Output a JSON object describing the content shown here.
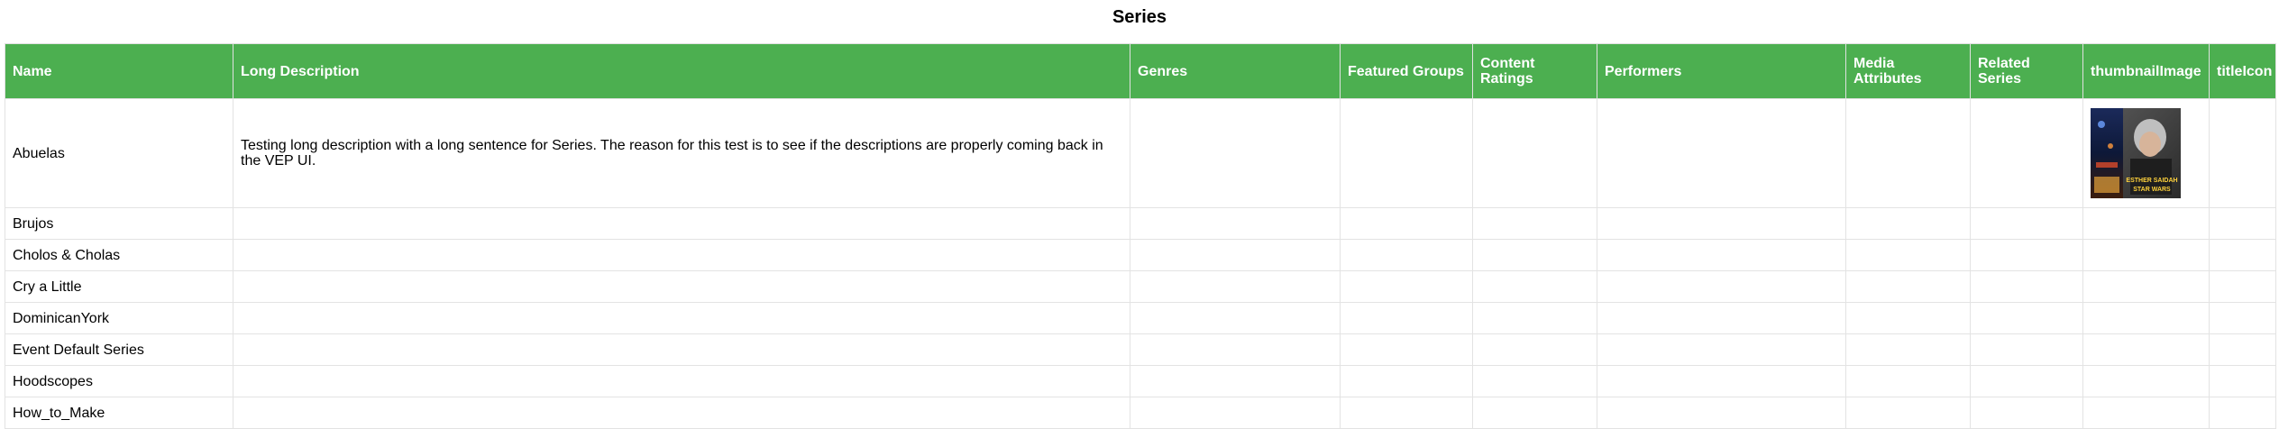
{
  "page": {
    "title": "Series"
  },
  "table": {
    "headers": [
      "Name",
      "Long Description",
      "Genres",
      "Featured Groups",
      "Content Ratings",
      "Performers",
      "Media Attributes",
      "Related Series",
      "thumbnailImage",
      "titleIcon"
    ],
    "rows": [
      {
        "name": "Abuelas",
        "long_description": "Testing long description with a long sentence for Series. The reason for this test is to see if the descriptions are properly coming back in the VEP UI.",
        "thumbnail_image": "poster-image",
        "thumbnail_text": "\"ESTHER SAIDAH\" STAR WARS"
      },
      {
        "name": "Brujos",
        "long_description": ""
      },
      {
        "name": "Cholos & Cholas",
        "long_description": ""
      },
      {
        "name": "Cry a Little",
        "long_description": ""
      },
      {
        "name": "DominicanYork",
        "long_description": ""
      },
      {
        "name": "Event Default Series",
        "long_description": ""
      },
      {
        "name": "Hoodscopes",
        "long_description": ""
      },
      {
        "name": "How_to_Make",
        "long_description": ""
      }
    ]
  },
  "colors": {
    "header_background": "#4caf50",
    "header_text": "#ffffff",
    "grid_line": "#e3e3e3"
  }
}
